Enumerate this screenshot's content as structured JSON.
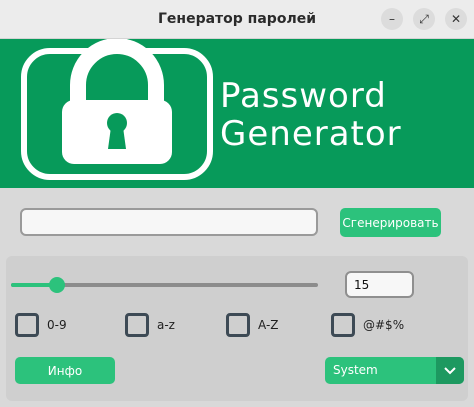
{
  "window": {
    "title": "Генератор паролей",
    "buttons": {
      "minimize": "–",
      "maximize": "⤢",
      "close": "✕"
    }
  },
  "banner": {
    "line1": "Password",
    "line2": "Generator",
    "background": "#079a5a",
    "icon": "lock-icon"
  },
  "password_field": {
    "value": "",
    "placeholder": ""
  },
  "generate_button": {
    "label": "Сгенерировать"
  },
  "length": {
    "value": "15",
    "slider_fraction": 0.15
  },
  "options": [
    {
      "label": "0-9",
      "checked": false
    },
    {
      "label": "a-z",
      "checked": false
    },
    {
      "label": "A-Z",
      "checked": false
    },
    {
      "label": "@#$%",
      "checked": false
    }
  ],
  "info_button": {
    "label": "Инфо"
  },
  "theme_select": {
    "value": "System"
  },
  "colors": {
    "accent": "#2cc27c",
    "accent_dark": "#1d9960",
    "banner": "#079a5a"
  }
}
